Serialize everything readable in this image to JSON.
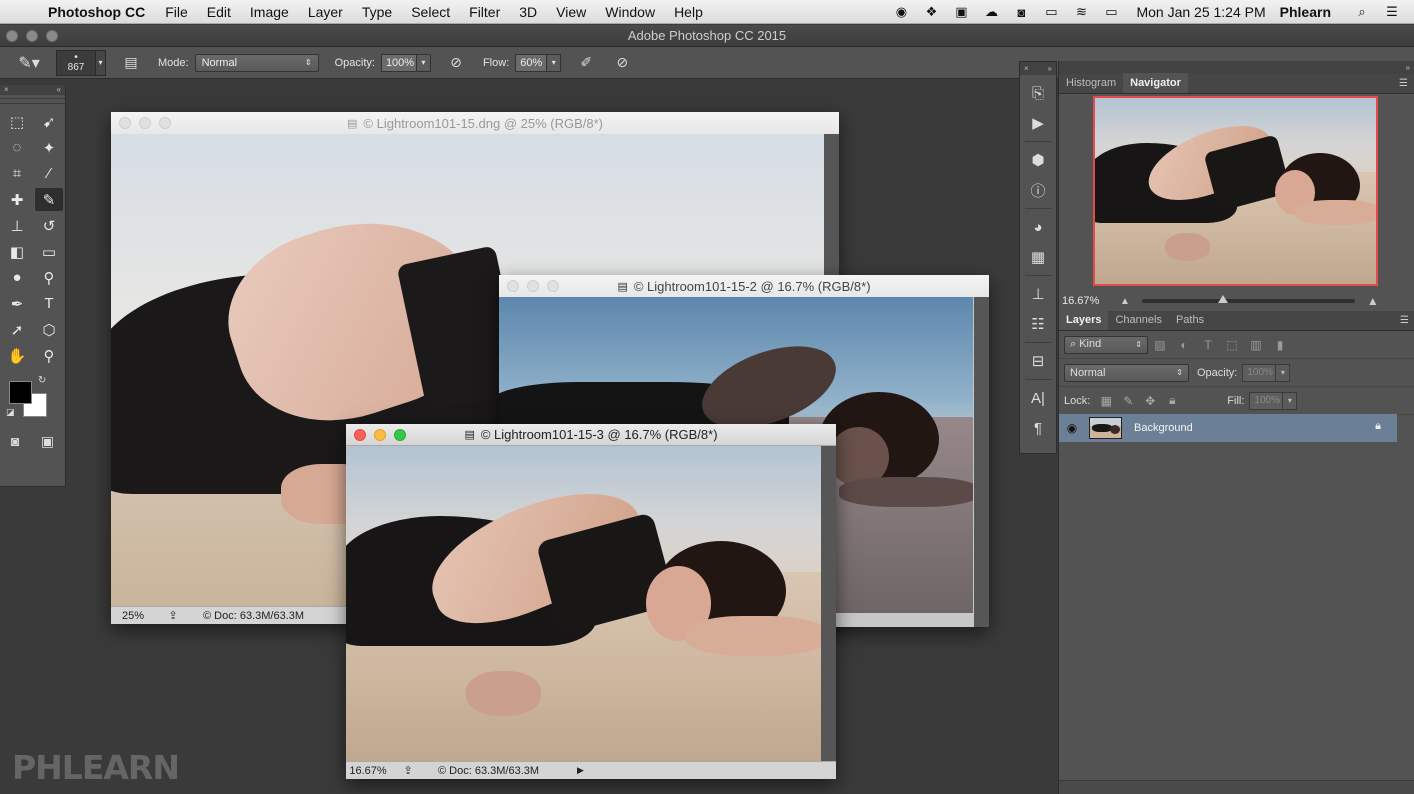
{
  "menubar": {
    "app_name": "Photoshop CC",
    "items": [
      "File",
      "Edit",
      "Image",
      "Layer",
      "Type",
      "Select",
      "Filter",
      "3D",
      "View",
      "Window",
      "Help"
    ],
    "clock": "Mon Jan 25  1:24 PM",
    "user": "Phlearn",
    "status_icons": [
      "record-icon",
      "dropbox-icon",
      "window-icon",
      "creative-cloud-icon",
      "camera-icon",
      "airplay-icon",
      "wifi-icon",
      "battery-icon"
    ]
  },
  "app": {
    "title": "Adobe Photoshop CC 2015"
  },
  "options": {
    "brush_size": "867",
    "mode_label": "Mode:",
    "mode_value": "Normal",
    "opacity_label": "Opacity:",
    "opacity_value": "100%",
    "flow_label": "Flow:",
    "flow_value": "60%"
  },
  "documents": [
    {
      "title": "© Lightroom101-15.dng @ 25% (RGB/8*)",
      "zoom": "25%",
      "doc_size": "Doc: 63.3M/63.3M"
    },
    {
      "title": "© Lightroom101-15-2 @ 16.7% (RGB/8*)"
    },
    {
      "title": "© Lightroom101-15-3 @ 16.7% (RGB/8*)",
      "zoom": "16.67%",
      "doc_size": "Doc: 63.3M/63.3M"
    }
  ],
  "navigator": {
    "tabs": [
      "Histogram",
      "Navigator"
    ],
    "active_tab": "Navigator",
    "zoom": "16.67%",
    "zoom_slider_fraction": 0.38
  },
  "layers_panel": {
    "tabs": [
      "Layers",
      "Channels",
      "Paths"
    ],
    "active_tab": "Layers",
    "filter_kind": "Kind",
    "blend_mode": "Normal",
    "opacity_label": "Opacity:",
    "opacity_value": "100%",
    "lock_label": "Lock:",
    "fill_label": "Fill:",
    "fill_value": "100%",
    "layers": [
      {
        "name": "Background",
        "visible": true,
        "locked": true
      }
    ]
  },
  "watermark": "PHLEARN",
  "colors": {
    "ui_dark": "#535353",
    "workspace": "#3a3a3a",
    "selected_layer": "#6b7f96",
    "navigator_frame": "#e64a4a"
  }
}
